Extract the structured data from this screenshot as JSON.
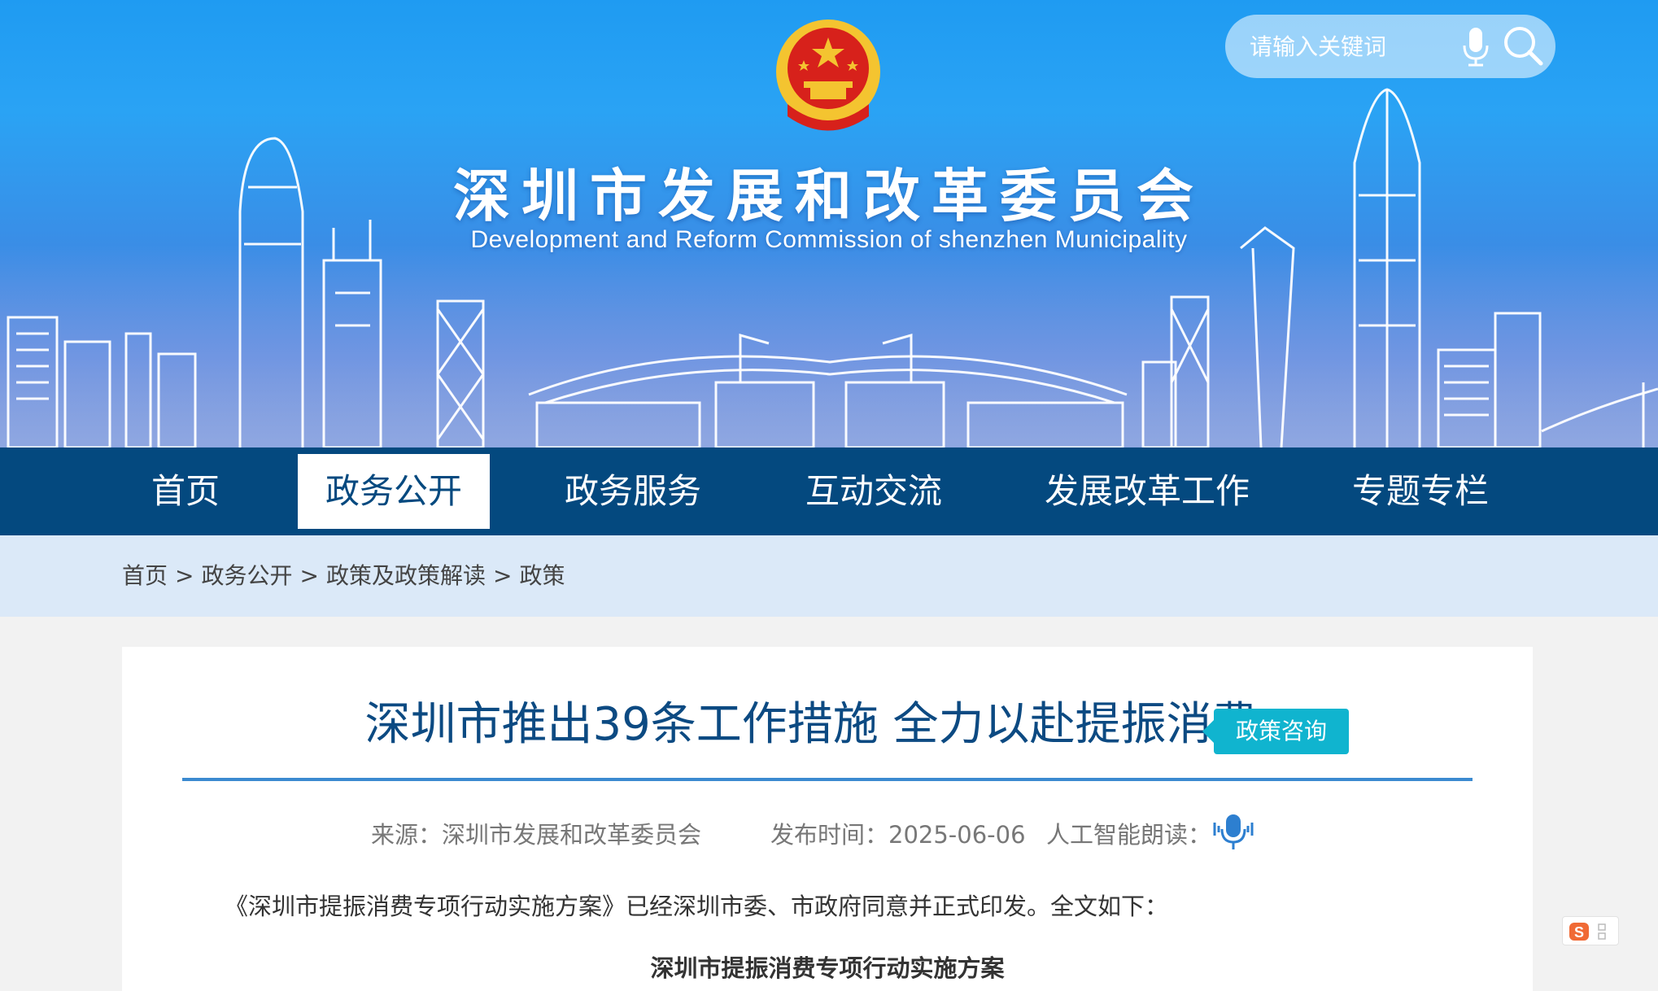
{
  "header": {
    "site_title": "深圳市发展和改革委员会",
    "site_subtitle": "Development and Reform Commission of shenzhen Municipality",
    "search": {
      "placeholder": "请输入关键词"
    }
  },
  "nav": {
    "items": [
      {
        "label": "首页",
        "active": false
      },
      {
        "label": "政务公开",
        "active": true
      },
      {
        "label": "政务服务",
        "active": false
      },
      {
        "label": "互动交流",
        "active": false
      },
      {
        "label": "发展改革工作",
        "active": false
      },
      {
        "label": "专题专栏",
        "active": false
      }
    ]
  },
  "breadcrumb": {
    "items": [
      "首页",
      "政务公开",
      "政策及政策解读",
      "政策"
    ],
    "separator": ">"
  },
  "article": {
    "title": "深圳市推出39条工作措施 全力以赴提振消费",
    "badge": "政策咨询",
    "source": "来源：深圳市发展和改革委员会",
    "publish_time": "发布时间：2025-06-06",
    "ai_read_label": "人工智能朗读：",
    "intro": "《深圳市提振消费专项行动实施方案》已经深圳市委、市政府同意并正式印发。全文如下：",
    "doc_heading": "深圳市提振消费专项行动实施方案"
  },
  "colors": {
    "nav_bg": "#04497f",
    "title_blue": "#0c4a82",
    "badge_teal": "#10b4cf",
    "breadcrumb_bg": "#dbe9f8"
  },
  "icons": [
    "national-emblem-icon",
    "microphone-icon",
    "search-icon",
    "speaker-icon",
    "ime-icon"
  ]
}
